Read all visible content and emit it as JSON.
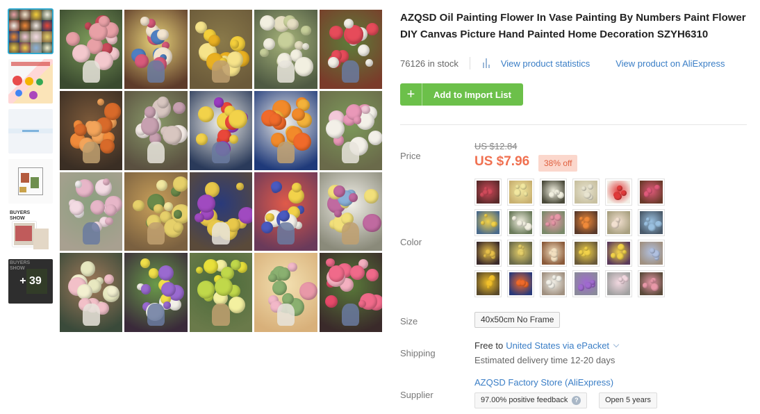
{
  "thumbnails": [
    {
      "kind": "grid",
      "active": true
    },
    {
      "kind": "promo"
    },
    {
      "kind": "blank"
    },
    {
      "kind": "diagram"
    },
    {
      "kind": "buyers-show"
    },
    {
      "kind": "more",
      "more_label": "+ 39"
    }
  ],
  "product": {
    "title": "AZQSD Oil Painting Flower In Vase Painting By Numbers Paint Flower DIY Canvas Picture Hand Painted Home Decoration SZYH6310",
    "stock": "76126 in stock",
    "stats_link": "View product statistics",
    "aliexpress_link": "View product on AliExpress",
    "add_button": "Add to Import List"
  },
  "price": {
    "label": "Price",
    "old": "US $12.84",
    "new": "US $7.96",
    "discount": "38% off"
  },
  "color": {
    "label": "Color",
    "swatch_count": 24
  },
  "size": {
    "label": "Size",
    "value": "40x50cm No Frame"
  },
  "shipping": {
    "label": "Shipping",
    "free": "Free to",
    "destination": "United States via ePacket",
    "delivery": "Estimated delivery time 12-20 days"
  },
  "supplier": {
    "label": "Supplier",
    "name": "AZQSD Factory Store (AliExpress)",
    "feedback": "97.00% positive feedback",
    "help_icon": "?",
    "open": "Open 5 years"
  },
  "colors": {
    "accent_green": "#6cc04a",
    "price_orange": "#f07151",
    "link_blue": "#3a7ec6",
    "active_border": "#2fa9d0"
  }
}
